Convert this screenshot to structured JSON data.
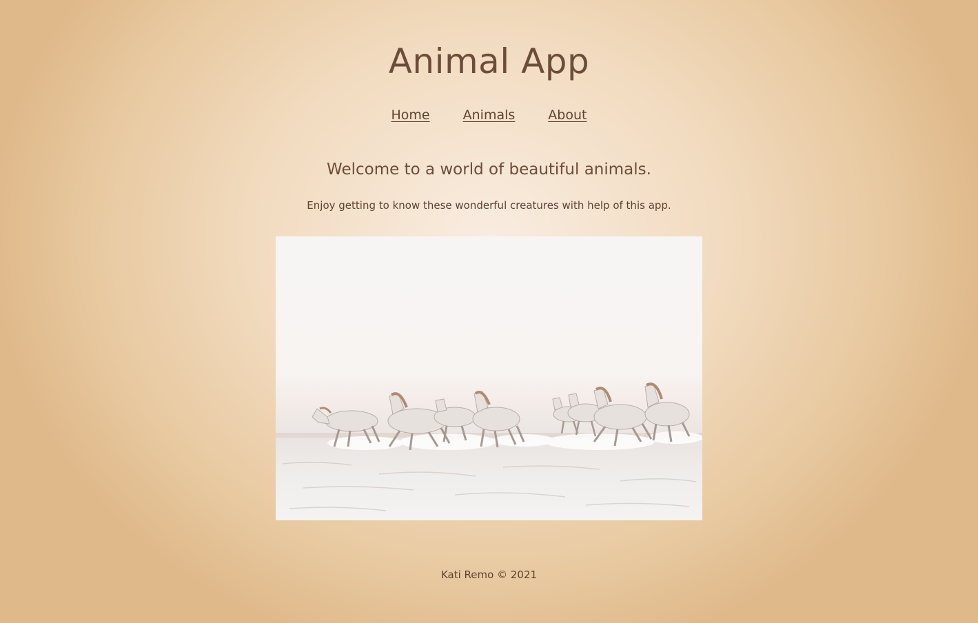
{
  "header": {
    "title": "Animal App"
  },
  "nav": {
    "items": [
      {
        "label": "Home"
      },
      {
        "label": "Animals"
      },
      {
        "label": "About"
      }
    ]
  },
  "main": {
    "heading": "Welcome to a world of beautiful animals.",
    "subtitle": "Enjoy getting to know these wonderful creatures with help of this app.",
    "hero_image": {
      "alt": "White horses running through water",
      "icon": "horses-image"
    }
  },
  "footer": {
    "text": "Kati Remo © 2021"
  },
  "colors": {
    "text": "#6d4d3a",
    "background_center": "#f9ece0",
    "background_edge": "#dfb98a"
  }
}
